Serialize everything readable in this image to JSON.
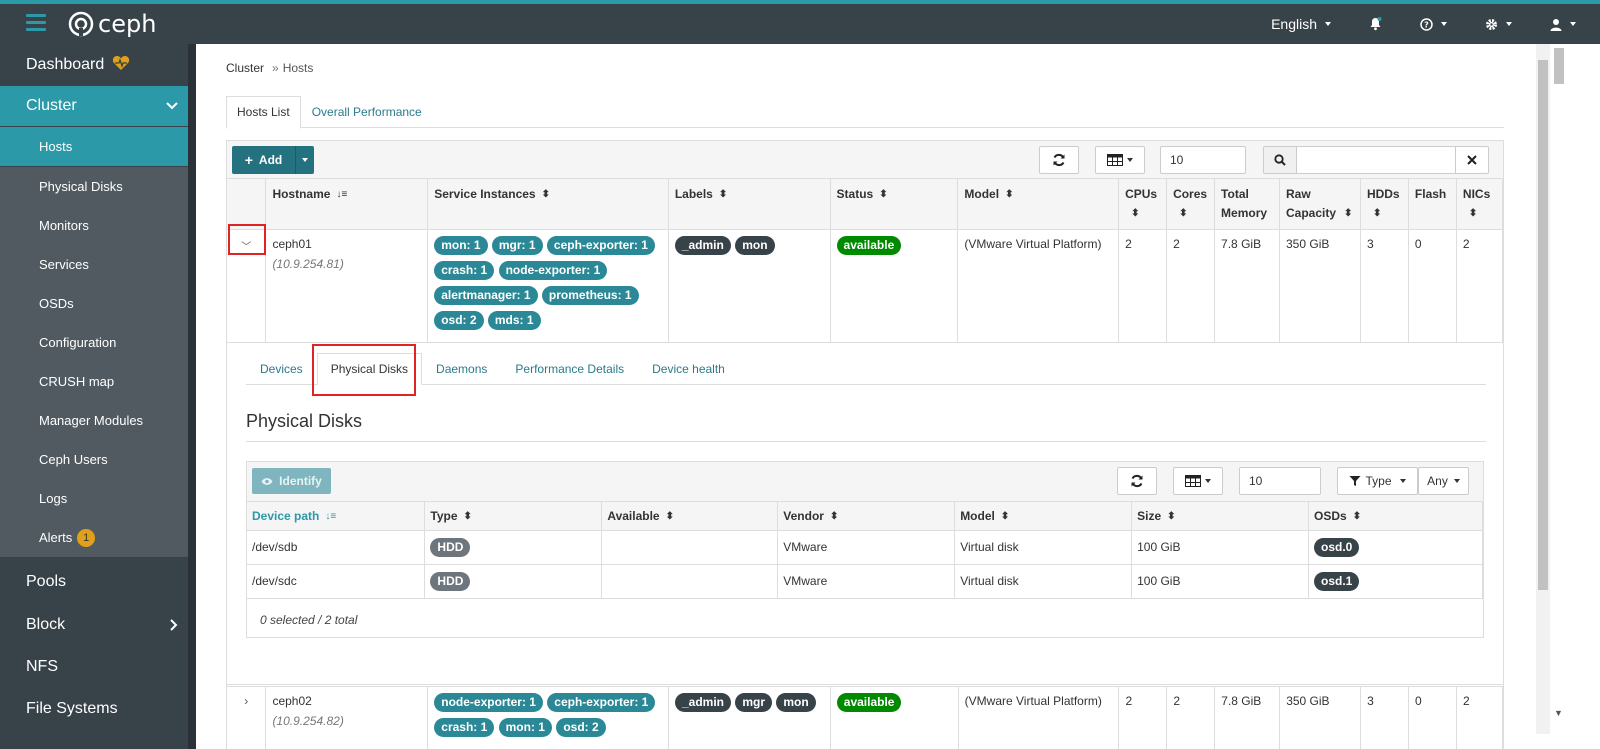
{
  "navbar": {
    "brand": "ceph",
    "language": "English",
    "colors": {
      "navbar": "#374249",
      "accent": "#2b99a8"
    }
  },
  "sidebar": {
    "dashboard": "Dashboard",
    "cluster": "Cluster",
    "cluster_items": [
      "Hosts",
      "Physical Disks",
      "Monitors",
      "Services",
      "OSDs",
      "Configuration",
      "CRUSH map",
      "Manager Modules",
      "Ceph Users",
      "Logs",
      "Alerts"
    ],
    "alerts_count": "1",
    "pools": "Pools",
    "block": "Block",
    "nfs": "NFS",
    "file_systems": "File Systems"
  },
  "breadcrumb": {
    "root": "Cluster",
    "sep": "»",
    "current": "Hosts"
  },
  "tabs": [
    "Hosts List",
    "Overall Performance"
  ],
  "toolbar": {
    "add_label": "Add",
    "page_size": "10",
    "search_value": ""
  },
  "hosts_table": {
    "columns": [
      "Hostname",
      "Service Instances",
      "Labels",
      "Status",
      "Model",
      "CPUs",
      "Cores",
      "Total Memory",
      "Raw Capacity",
      "HDDs",
      "Flash",
      "NICs"
    ],
    "rows": [
      {
        "hostname": "ceph01",
        "addr": "(10.9.254.81)",
        "services": [
          "mon: 1",
          "mgr: 1",
          "ceph-exporter: 1",
          "crash: 1",
          "node-exporter: 1",
          "alertmanager: 1",
          "prometheus: 1",
          "osd: 2",
          "mds: 1"
        ],
        "labels": [
          "_admin",
          "mon"
        ],
        "status": "available",
        "model": "(VMware Virtual Platform)",
        "cpus": "2",
        "cores": "2",
        "memory": "7.8 GiB",
        "capacity": "350 GiB",
        "hdds": "3",
        "flash": "0",
        "nics": "2"
      },
      {
        "hostname": "ceph02",
        "addr": "(10.9.254.82)",
        "services": [
          "node-exporter: 1",
          "ceph-exporter: 1",
          "crash: 1",
          "mon: 1",
          "osd: 2"
        ],
        "labels": [
          "_admin",
          "mgr",
          "mon"
        ],
        "status": "available",
        "model": "(VMware Virtual Platform)",
        "cpus": "2",
        "cores": "2",
        "memory": "7.8 GiB",
        "capacity": "350 GiB",
        "hdds": "3",
        "flash": "0",
        "nics": "2"
      }
    ]
  },
  "detail": {
    "tabs": [
      "Devices",
      "Physical Disks",
      "Daemons",
      "Performance Details",
      "Device health"
    ],
    "title": "Physical Disks",
    "identify_label": "Identify",
    "page_size": "10",
    "type_filter": "Type",
    "any_filter": "Any",
    "columns": [
      "Device path",
      "Type",
      "Available",
      "Vendor",
      "Model",
      "Size",
      "OSDs"
    ],
    "rows": [
      {
        "path": "/dev/sdb",
        "type": "HDD",
        "available": "",
        "vendor": "VMware",
        "model": "Virtual disk",
        "size": "100 GiB",
        "osd": "osd.0"
      },
      {
        "path": "/dev/sdc",
        "type": "HDD",
        "available": "",
        "vendor": "VMware",
        "model": "Virtual disk",
        "size": "100 GiB",
        "osd": "osd.1"
      }
    ],
    "footer": "0 selected / 2 total"
  }
}
